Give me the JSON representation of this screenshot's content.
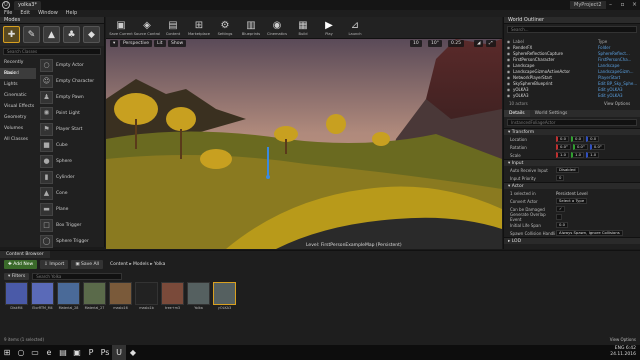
{
  "window": {
    "tab_label": "yolka3*",
    "project_label": "MyProject2",
    "menu": [
      "File",
      "Edit",
      "Window",
      "Help"
    ]
  },
  "modes_panel": {
    "title": "Modes",
    "search_placeholder": "Search Classes",
    "categories": [
      "Recently Placed",
      "Basic",
      "Lights",
      "Cinematic",
      "Visual Effects",
      "Geometry",
      "Volumes",
      "All Classes"
    ],
    "selected_category": "Basic",
    "items": [
      "Empty Actor",
      "Empty Character",
      "Empty Pawn",
      "Point Light",
      "Player Start",
      "Cube",
      "Sphere",
      "Cylinder",
      "Cone",
      "Plane",
      "Box Trigger",
      "Sphere Trigger"
    ]
  },
  "toolbar": {
    "buttons": [
      {
        "label": "Save Current",
        "icon": "save-icon"
      },
      {
        "label": "Source Control",
        "icon": "source-control-icon"
      },
      {
        "label": "Content",
        "icon": "content-icon"
      },
      {
        "label": "Marketplace",
        "icon": "marketplace-icon"
      },
      {
        "label": "Settings",
        "icon": "settings-icon"
      },
      {
        "label": "Blueprints",
        "icon": "blueprints-icon"
      },
      {
        "label": "Cinematics",
        "icon": "cinematics-icon"
      },
      {
        "label": "Build",
        "icon": "build-icon"
      },
      {
        "label": "Play",
        "icon": "play-icon"
      },
      {
        "label": "Launch",
        "icon": "launch-icon"
      }
    ]
  },
  "viewport": {
    "perspective_label": "Perspective",
    "lit_label": "Lit",
    "show_label": "Show",
    "grid_value": "10",
    "rot_value": "10°",
    "scale_value": "0.25",
    "level_label": "Level: FirstPersonExampleMap (Persistent)"
  },
  "outliner": {
    "title": "World Outliner",
    "search_placeholder": "Search...",
    "col_label": "Label",
    "col_type": "Type",
    "rows": [
      {
        "label": "RenderFX",
        "type": "Folder"
      },
      {
        "label": "SphereReflectionCapture",
        "type": "SphereReflect..."
      },
      {
        "label": "FirstPersonCharacter",
        "type": "FirstPersonCha..."
      },
      {
        "label": "Landscape",
        "type": "Landscape"
      },
      {
        "label": "LandscapeGizmoActiveActor",
        "type": "LandscapeGizm..."
      },
      {
        "label": "NetworkPlayerStart",
        "type": "PlayerStart"
      },
      {
        "label": "SkySphereBlueprint",
        "type": "Edit BP_Sky_Sphe..."
      },
      {
        "label": "yOLKA3",
        "type": "Edit yOLKA3"
      },
      {
        "label": "yOLKA3",
        "type": "Edit yOLKA3"
      }
    ],
    "count": "10 actors",
    "view_options": "View Options"
  },
  "details": {
    "tab_details": "Details",
    "tab_world": "World Settings",
    "actor_name": "InstancedFoliageActor",
    "transform_title": "Transform",
    "location_label": "Location",
    "rotation_label": "Rotation",
    "scale_label": "Scale",
    "location": [
      "0.0",
      "0.0",
      "0.0"
    ],
    "rotation": [
      "0.0°",
      "0.0°",
      "0.0°"
    ],
    "scale": [
      "1.0",
      "1.0",
      "1.0"
    ],
    "input_title": "Input",
    "auto_receive_label": "Auto Receive Input",
    "auto_receive_value": "Disabled",
    "input_priority_label": "Input Priority",
    "input_priority_value": "0",
    "actor_title": "Actor",
    "selected_count": "1 selected in",
    "selected_level": "Persistent Level",
    "convert_label": "Convert Actor",
    "convert_value": "Select a Type",
    "can_be_damaged": "Can be Damaged",
    "overlap_label": "Generate Overlap Event",
    "initial_life_label": "Initial Life Span",
    "initial_life_value": "0.0",
    "spawn_label": "Spawn Collision Handli",
    "spawn_value": "Always Spawn, Ignore Collisions",
    "lod_title": "LOD"
  },
  "content_browser": {
    "title": "Content Browser",
    "add_new": "Add New",
    "import": "Import",
    "save_all": "Save All",
    "breadcrumb": "Content ▸ Models ▸ Yolka",
    "filters": "Filters",
    "search_placeholder": "Search Yolka",
    "assets": [
      {
        "name": "DiskM4",
        "color": "#4a5aa8"
      },
      {
        "name": "ElorRTM_M4",
        "color": "#5a6ab8"
      },
      {
        "name": "Material_28",
        "color": "#4a6a98"
      },
      {
        "name": "Material_27",
        "color": "#5a6a4a"
      },
      {
        "name": "maslo16",
        "color": "#7a5a3a"
      },
      {
        "name": "maslo1b",
        "color": "#222222"
      },
      {
        "name": "tree+m3",
        "color": "#7a4a3a"
      },
      {
        "name": "Yolka",
        "color": "#556060"
      },
      {
        "name": "yOLKA3",
        "color": "#556060"
      }
    ],
    "selected_asset": "yOLKA3",
    "status": "9 items (1 selected)",
    "view_options": "View Options"
  },
  "taskbar": {
    "time": "6:42",
    "date": "24.11.2016",
    "language": "ENG"
  }
}
